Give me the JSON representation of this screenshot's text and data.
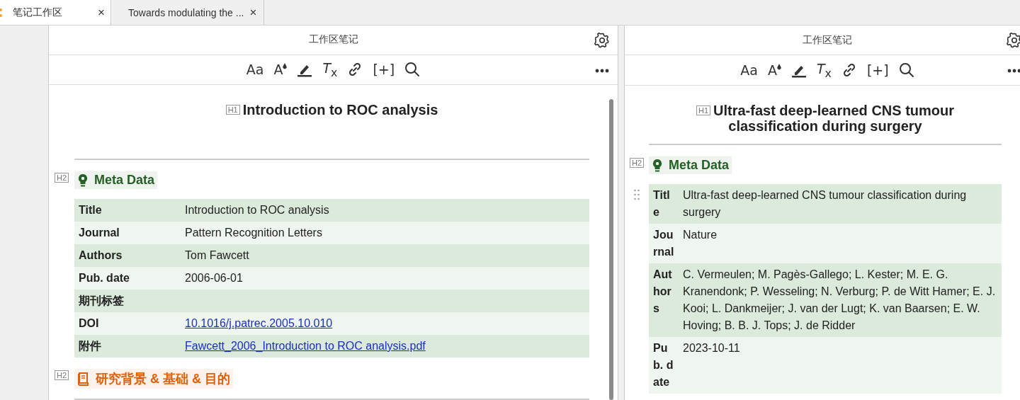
{
  "tabs": [
    {
      "label": "笔记工作区",
      "selected": true,
      "close": "×"
    },
    {
      "label": "Towards modulating the ...",
      "selected": false,
      "close": "×"
    }
  ],
  "panes": [
    {
      "header_title": "工作区笔记",
      "toolbar": [
        {
          "kind": "font",
          "label": "Aa"
        },
        {
          "kind": "color",
          "label": "A"
        },
        {
          "kind": "highlight"
        },
        {
          "kind": "clear",
          "label": "*T*$_{x}$"
        },
        {
          "kind": "link"
        },
        {
          "kind": "insert",
          "label": "[+]"
        },
        {
          "kind": "search"
        }
      ],
      "h1_tag": "H1",
      "title": "Introduction to ROC analysis",
      "sections": [
        {
          "tag": "H2",
          "heading": "Meta Data",
          "kind": "bulb",
          "color": "#236023",
          "rows": [
            {
              "label": "Title",
              "value": "Introduction to ROC analysis",
              "kind": "text"
            },
            {
              "label": "Journal",
              "value": "Pattern Recognition Letters",
              "kind": "text"
            },
            {
              "label": "Authors",
              "value": "Tom Fawcett",
              "kind": "text"
            },
            {
              "label": "Pub. date",
              "value": "2006-06-01",
              "kind": "text"
            },
            {
              "label": "期刊标签"
            },
            {
              "label": "DOI",
              "value": "10.1016/j.patrec.2005.10.010",
              "kind": "link"
            },
            {
              "label": "附件",
              "value": "Fawcett_2006_Introduction to ROC analysis.pdf",
              "kind": "link"
            }
          ]
        },
        {
          "tag": "H2",
          "heading": "研究背景 & 基础 & 目的",
          "kind": "book",
          "color": "#e0600a"
        }
      ]
    },
    {
      "header_title": "工作区笔记",
      "toolbar": [
        {
          "kind": "font",
          "label": "Aa"
        },
        {
          "kind": "color",
          "label": "A"
        },
        {
          "kind": "highlight"
        },
        {
          "kind": "clear",
          "label": "*T*$_{x}$"
        },
        {
          "kind": "link"
        },
        {
          "kind": "insert",
          "label": "[+]"
        },
        {
          "kind": "search"
        }
      ],
      "h1_tag": "H1",
      "title": "Ultra-fast deep-learned CNS tumour classification during surgery",
      "sections": [
        {
          "tag": "H2",
          "heading": "Meta Data",
          "kind": "bulb",
          "color": "#236023",
          "rows": [
            {
              "label": "Title",
              "value": "Ultra-fast deep-learned CNS tumour classification during surgery",
              "kind": "text"
            },
            {
              "label": "Journal",
              "value": "Nature",
              "kind": "text"
            },
            {
              "label": "Authors",
              "value": "C. Vermeulen; M. Pagès-Gallego; L. Kester; M. E. G. Kranendonk; P. Wesseling; N. Verburg; P. de Witt Hamer; E. J. Kooi; L. Dankmeijer; J. van der Lugt; K. van Baarsen; E. W. Hoving; B. B. J. Tops; J. de Ridder",
              "kind": "text"
            },
            {
              "label": "Pub. date",
              "value": "2023-10-11",
              "kind": "text"
            }
          ]
        }
      ]
    }
  ]
}
